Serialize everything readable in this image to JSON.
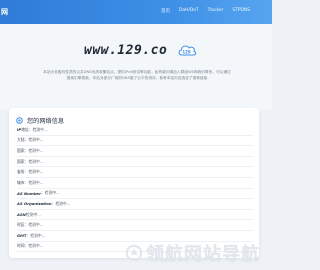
{
  "header": {
    "brand": "网",
    "nav": [
      "首页",
      "DoH/DoT",
      "Tracker",
      "STPDNS"
    ]
  },
  "hero": {
    "logo_text": "www.129.co",
    "cloud_badge": "129",
    "intro": "本站为非盈利性质的公共DNS优质收集站点，提供IPv6测试等功能，如有疑问请加入群组WS和我们联系，可以通过搜索引擎搜索，本站对部分厂商的DNS做了公平的测评，参考本站内容选定了推荐链接"
  },
  "card": {
    "title": "您的网络信息",
    "rows": [
      {
        "key": "IP",
        "label": " 地址：",
        "value": "检测中..."
      },
      {
        "key": "",
        "label": "大陆：",
        "value": "检测中..."
      },
      {
        "key": "",
        "label": "国家：",
        "value": "检测中..."
      },
      {
        "key": "",
        "label": "国家：",
        "value": "检测中..."
      },
      {
        "key": "",
        "label": "省份：",
        "value": "检测中..."
      },
      {
        "key": "",
        "label": "城市：",
        "value": "检测中..."
      },
      {
        "key": "AS Number",
        "label": "：",
        "value": "检测中..."
      },
      {
        "key": "AS Organization",
        "label": "：",
        "value": "检测中..."
      },
      {
        "key": "ASN",
        "label": " 检测中...",
        "value": ""
      },
      {
        "key": "",
        "label": "时区：",
        "value": "检测中..."
      },
      {
        "key": "GMT",
        "label": "：",
        "value": "检测中..."
      },
      {
        "key": "",
        "label": "时间：",
        "value": "检测中..."
      }
    ]
  },
  "watermark": {
    "text": "领航网站导航"
  },
  "colors": {
    "topbar": "#3c8fe6",
    "accent": "#3c8fe6",
    "text": "#1f2a36"
  }
}
